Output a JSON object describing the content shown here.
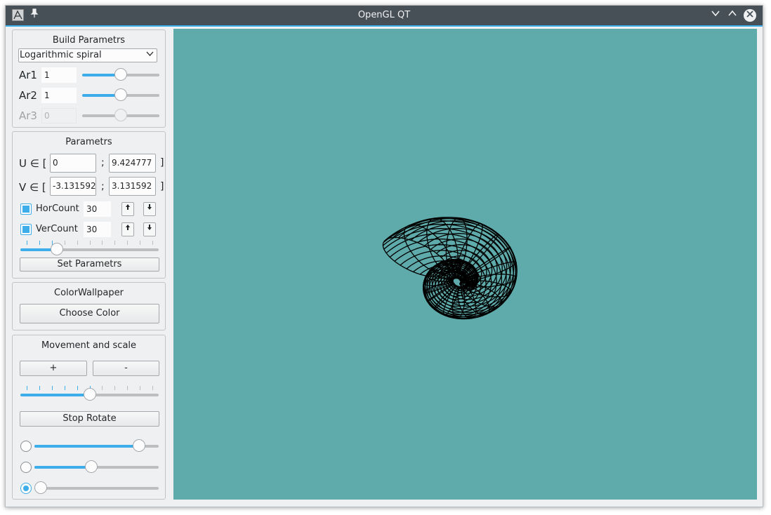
{
  "window": {
    "title": "OpenGL QT"
  },
  "build": {
    "title": "Build Parametrs",
    "curve": "Logarithmic spiral",
    "ar1_label": "Ar1",
    "ar1_value": "1",
    "ar1_slider": 0.5,
    "ar2_label": "Ar2",
    "ar2_value": "1",
    "ar2_slider": 0.5,
    "ar3_label": "Ar3",
    "ar3_value": "0",
    "ar3_slider": 0.5
  },
  "params": {
    "title": "Parametrs",
    "u_label": "U ∈ [",
    "u_min": "0",
    "u_max": "9.424777",
    "v_label": "V ∈ [",
    "v_min": "-3.131592",
    "v_max": "3.131592",
    "sep": ";",
    "close": "]",
    "hor_label": "HorCount",
    "hor_value": "30",
    "ver_label": "VerCount",
    "ver_value": "30",
    "count_slider": 0.24,
    "set_button": "Set Parametrs"
  },
  "color": {
    "title": "ColorWallpaper",
    "choose_button": "Choose Color"
  },
  "movement": {
    "title": "Movement and scale",
    "plus": "+",
    "minus": "-",
    "scale_slider": 0.5,
    "stop_button": "Stop Rotate",
    "axis_sliders": [
      0.88,
      0.45,
      0.0
    ],
    "selected_axis": 2
  },
  "icons": {
    "app": "app-icon",
    "pin": "pin-icon",
    "minimize": "chevron-down-icon",
    "maximize": "chevron-up-icon",
    "close": "close-icon",
    "up": "arrow-up-icon",
    "down": "arrow-down-icon"
  },
  "colors": {
    "accent": "#3daee9",
    "viewport_bg": "#5faaaa",
    "wire": "#000000"
  }
}
